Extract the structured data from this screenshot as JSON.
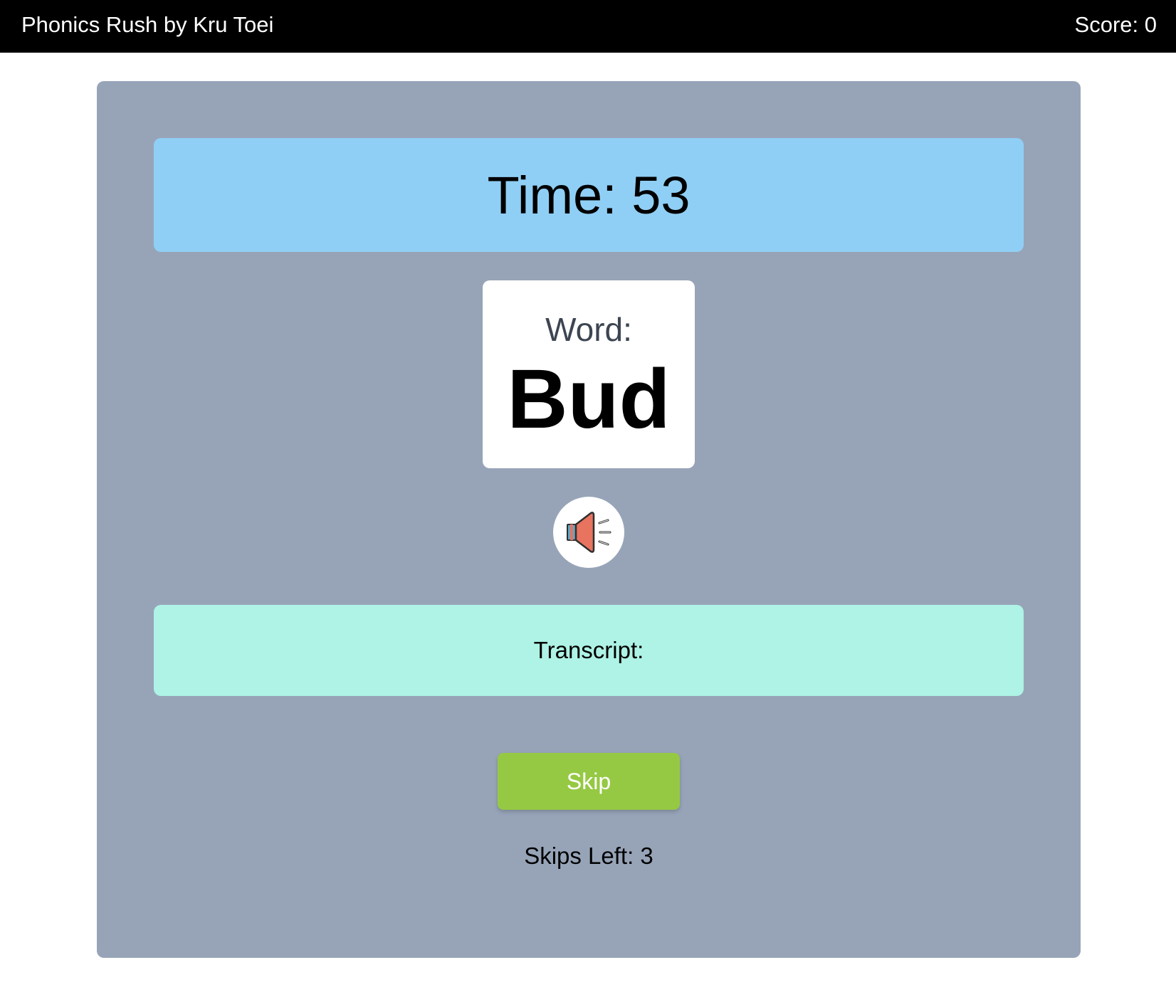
{
  "header": {
    "title": "Phonics Rush by Kru Toei",
    "score_text": "Score: 0"
  },
  "game": {
    "timer_text": "Time: 53",
    "word_label": "Word:",
    "word": "Bud",
    "speaker_icon": "speaker-icon",
    "transcript_text": "Transcript:",
    "skip_label": "Skip",
    "skips_left_text": "Skips Left: 3"
  },
  "colors": {
    "topbar": "#000000",
    "panel": "#97a4b8",
    "timer_bg": "#90cff5",
    "transcript_bg": "#aef3e5",
    "skip_button": "#95c943",
    "speaker_body": "#e8735f"
  }
}
